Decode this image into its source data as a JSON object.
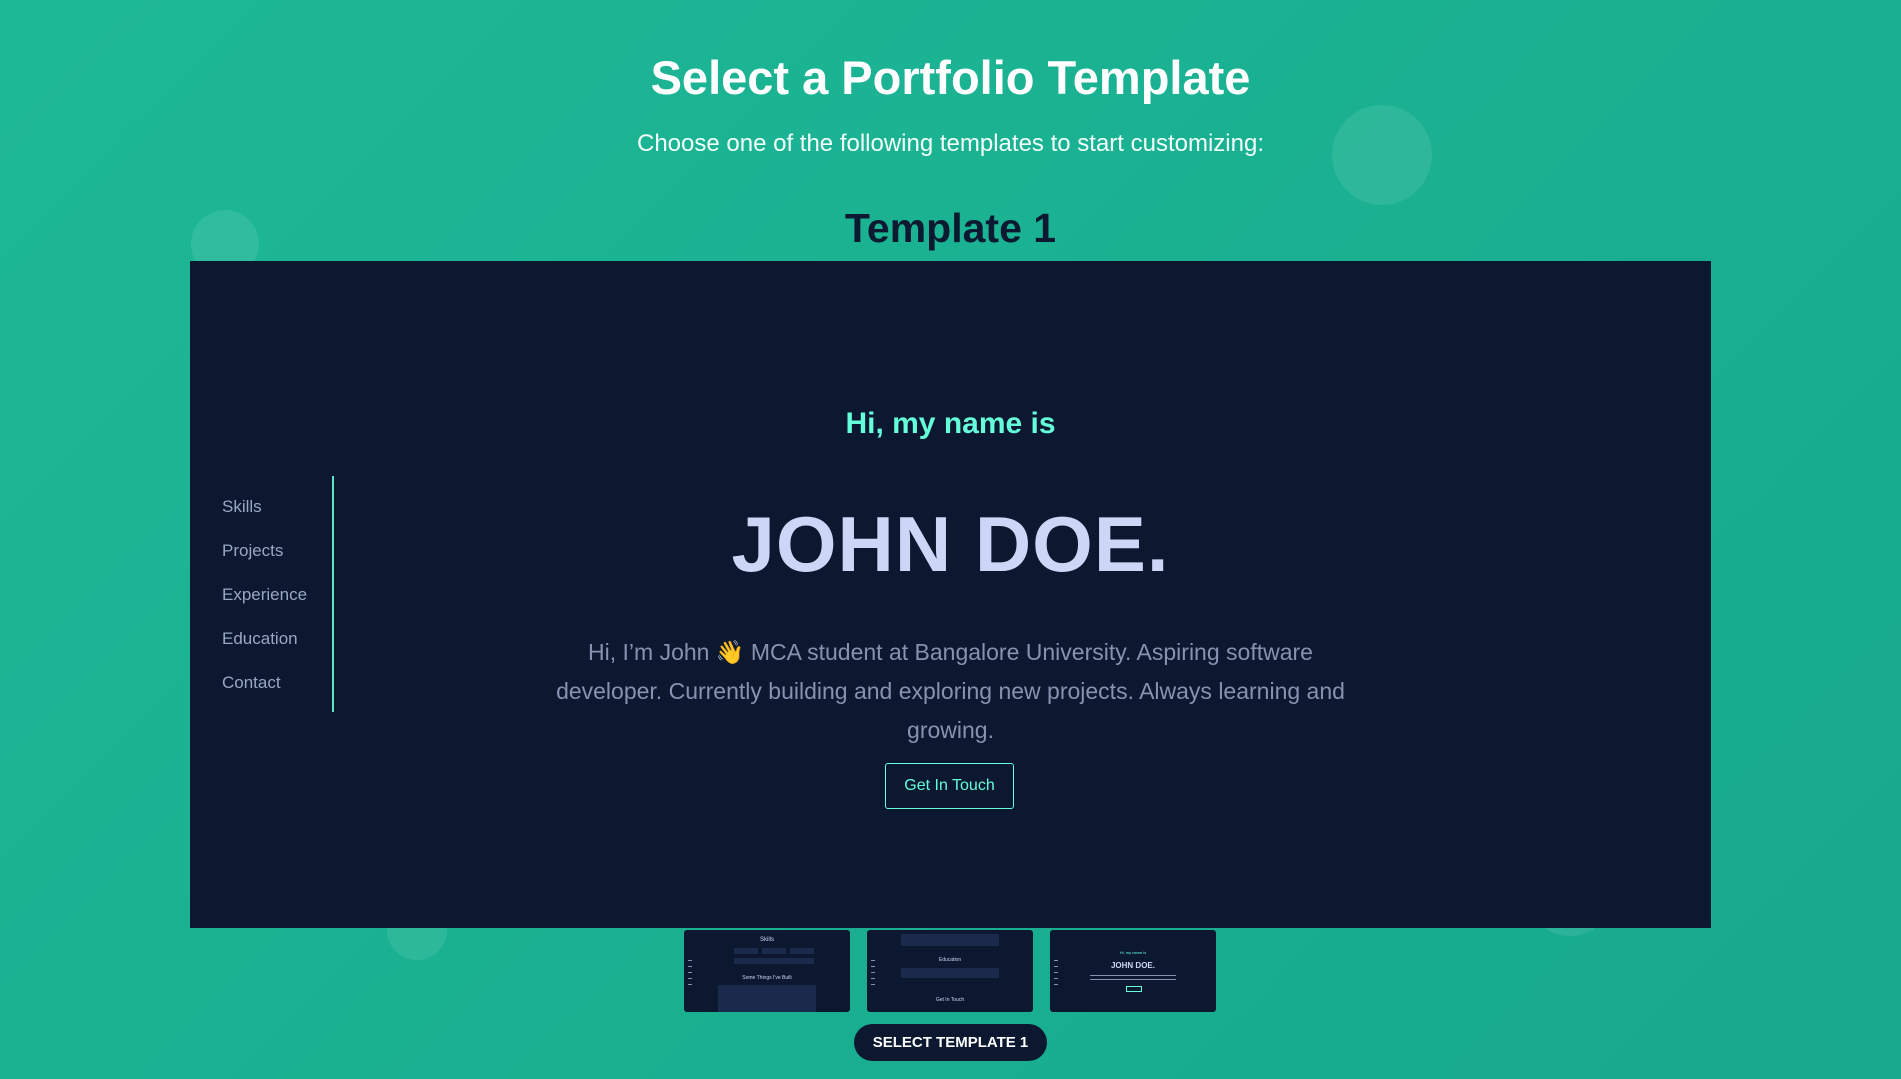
{
  "page": {
    "title": "Select a Portfolio Template",
    "subtitle": "Choose one of the following templates to start customizing:"
  },
  "template": {
    "heading": "Template 1",
    "select_label": "SELECT TEMPLATE 1"
  },
  "preview": {
    "nav_items": [
      "Skills",
      "Projects",
      "Experience",
      "Education",
      "Contact"
    ],
    "greeting": "Hi, my name is",
    "name": "JOHN DOE.",
    "bio": "Hi, I’m John 👋 MCA student at Bangalore University. Aspiring software developer. Currently building and exploring new projects. Always learning and growing.",
    "cta_label": "Get In Touch"
  },
  "thumbnails": [
    {
      "heading": "Skills",
      "section": "Some Things I've Built"
    },
    {
      "heading": "Education",
      "section": "Get In Touch"
    },
    {
      "greeting": "Hi, my name is",
      "name": "JOHN DOE."
    }
  ],
  "colors": {
    "background": "#1db896",
    "preview_bg": "#0b1830",
    "accent": "#64ffda",
    "name_text": "#cdd6f6",
    "muted_text": "#8892b0",
    "button_bg": "#0b1830"
  }
}
